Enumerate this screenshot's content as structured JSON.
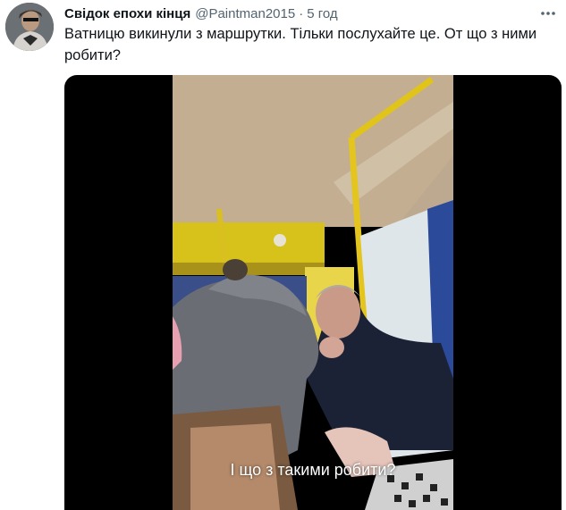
{
  "tweet": {
    "display_name": "Свідок епохи кінця",
    "handle": "@Paintman2015",
    "separator": "·",
    "time": "5 год",
    "more_icon": "more-horizontal-icon",
    "text": "Ватницю викинули з маршрутки. Тільки послухайте це. От що з ними робити?"
  },
  "media": {
    "caption": "І що з такими робити?"
  }
}
